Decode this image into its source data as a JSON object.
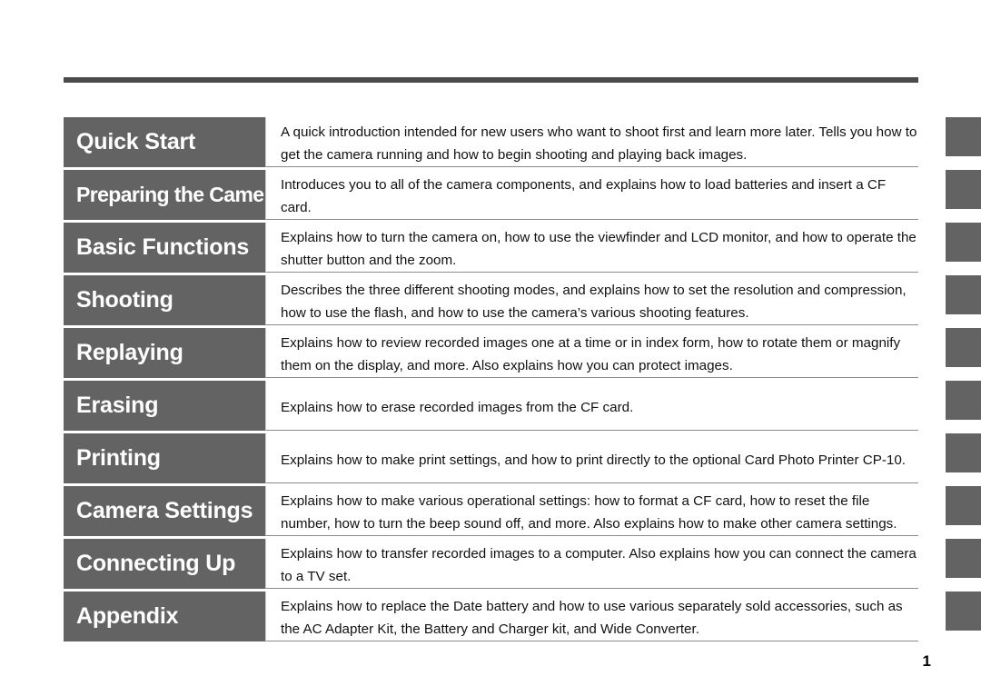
{
  "document": {
    "page_number": "1",
    "accent_gray": "#636363",
    "rule_color": "#4a4a4a"
  },
  "contents": {
    "rows": [
      {
        "label": "Quick Start",
        "description": "A quick introduction intended for new users who want to shoot first and learn more later. Tells you how to get the camera running and how to begin shooting and playing back images."
      },
      {
        "label": "Preparing the Camera",
        "description": "Introduces you to all of the camera components, and explains how to load batteries and insert a CF card."
      },
      {
        "label": "Basic Functions",
        "description": "Explains how to turn the camera on, how to use the viewfinder and LCD monitor, and how to operate the shutter button and the zoom."
      },
      {
        "label": "Shooting",
        "description": "Describes the three different shooting modes, and explains how to set the resolution and compression, how to use the flash, and how to use the camera’s various shooting features."
      },
      {
        "label": "Replaying",
        "description": "Explains how to review recorded images one at a time or in index form, how to rotate them or magnify them on the display, and more. Also explains how you can protect images."
      },
      {
        "label": "Erasing",
        "description": "Explains how to erase recorded images from the CF card."
      },
      {
        "label": "Printing",
        "description": "Explains how to make print settings, and how to print directly to the optional Card Photo Printer CP-10."
      },
      {
        "label": "Camera Settings",
        "description": "Explains how to make various operational settings: how to format a CF card, how to reset the file number, how to turn the beep sound off, and more. Also explains how to make other camera settings."
      },
      {
        "label": "Connecting Up",
        "description": "Explains how to transfer recorded images to a computer. Also explains how you can connect the camera to a TV set."
      },
      {
        "label": "Appendix",
        "description": "Explains how to replace the Date battery and how to use various separately sold accessories, such as the AC Adapter Kit, the Battery and Charger kit, and Wide Converter."
      }
    ]
  },
  "side_tabs": {
    "count": 10
  }
}
